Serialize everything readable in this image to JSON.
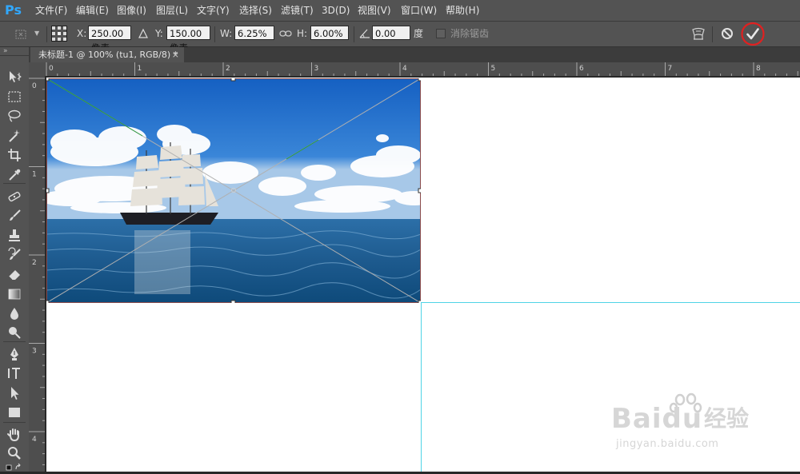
{
  "app": {
    "logo": "Ps"
  },
  "menu": [
    "文件(F)",
    "编辑(E)",
    "图像(I)",
    "图层(L)",
    "文字(Y)",
    "选择(S)",
    "滤镜(T)",
    "3D(D)",
    "视图(V)",
    "窗口(W)",
    "帮助(H)"
  ],
  "options": {
    "x_label": "X:",
    "x_value": "250.00 像素",
    "y_label": "Y:",
    "y_value": "150.00 像素",
    "w_label": "W:",
    "w_value": "6.25%",
    "h_label": "H:",
    "h_value": "6.00%",
    "angle_value": "0.00",
    "angle_unit": "度",
    "antialias_label": "消除锯齿"
  },
  "document": {
    "tab_title": "未标题-1 @ 100% (tu1, RGB/8) *",
    "close_glyph": "×"
  },
  "ruler": {
    "h_ticks": [
      "0",
      "1",
      "2",
      "3",
      "4",
      "5",
      "6",
      "7",
      "8"
    ],
    "v_ticks": [
      "0",
      "1",
      "2",
      "3",
      "4"
    ]
  },
  "watermark": {
    "brand": "Bai",
    "brand2": "du",
    "cn": "经验",
    "url": "jingyan.baidu.com"
  },
  "colors": {
    "chrome": "#535353",
    "commit_ring": "#e02020",
    "guide": "#4fd3e6",
    "ps_blue": "#31a8ff"
  }
}
